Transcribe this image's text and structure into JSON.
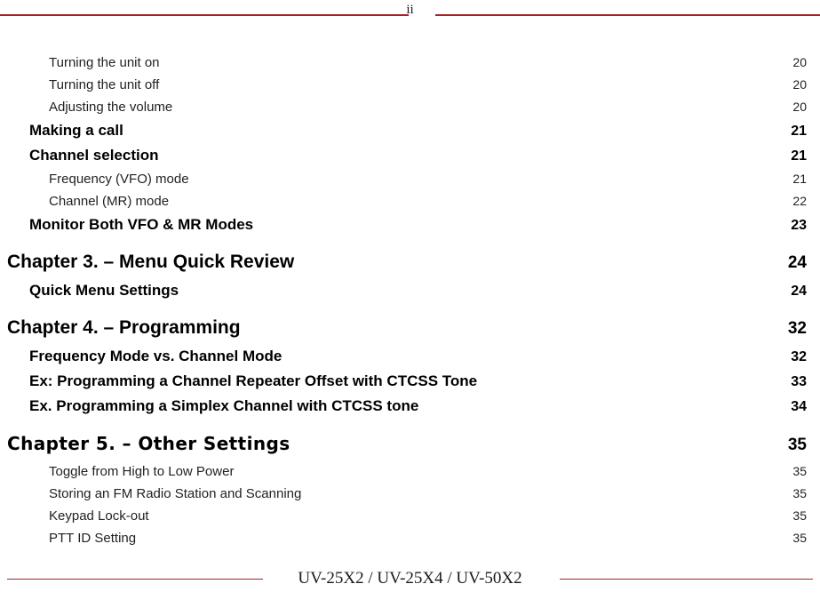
{
  "header": {
    "folio": "ii",
    "rule_color": "#a92127"
  },
  "toc": {
    "entries": [
      {
        "level": 2,
        "title": "Turning the unit on",
        "page": "20"
      },
      {
        "level": 2,
        "title": "Turning the unit off",
        "page": "20"
      },
      {
        "level": 2,
        "title": "Adjusting the volume",
        "page": "20"
      },
      {
        "level": 1,
        "title": "Making a call",
        "page": "21"
      },
      {
        "level": 1,
        "title": "Channel selection",
        "page": "21"
      },
      {
        "level": 2,
        "title": "Frequency (VFO) mode",
        "page": "21"
      },
      {
        "level": 2,
        "title": "Channel (MR) mode",
        "page": "22"
      },
      {
        "level": 1,
        "title": "Monitor Both VFO & MR Modes",
        "page": "23"
      },
      {
        "level": 0,
        "title": "Chapter 3. – Menu Quick Review",
        "page": "24"
      },
      {
        "level": 1,
        "title": "Quick Menu Settings",
        "page": "24"
      },
      {
        "level": 0,
        "title": "Chapter 4. – Programming",
        "page": "32"
      },
      {
        "level": 1,
        "title": "Frequency Mode vs. Channel Mode",
        "page": "32"
      },
      {
        "level": 1,
        "title": "Ex: Programming a Channel Repeater Offset with CTCSS Tone",
        "page": "33"
      },
      {
        "level": 1,
        "title": "Ex. Programming a Simplex Channel with CTCSS tone",
        "page": "34"
      },
      {
        "level": 0,
        "title": "Chapter 5. – Other Settings",
        "page": "35",
        "alt_face": true
      },
      {
        "level": 2,
        "title": "Toggle from High to Low Power",
        "page": "35"
      },
      {
        "level": 2,
        "title": "Storing an FM Radio Station and Scanning",
        "page": "35"
      },
      {
        "level": 2,
        "title": "Keypad Lock-out",
        "page": "35"
      },
      {
        "level": 2,
        "title": "PTT ID Setting",
        "page": "35"
      }
    ]
  },
  "footer": {
    "text": "UV-25X2 / UV-25X4 / UV-50X2",
    "rule_color": "#a92127"
  }
}
